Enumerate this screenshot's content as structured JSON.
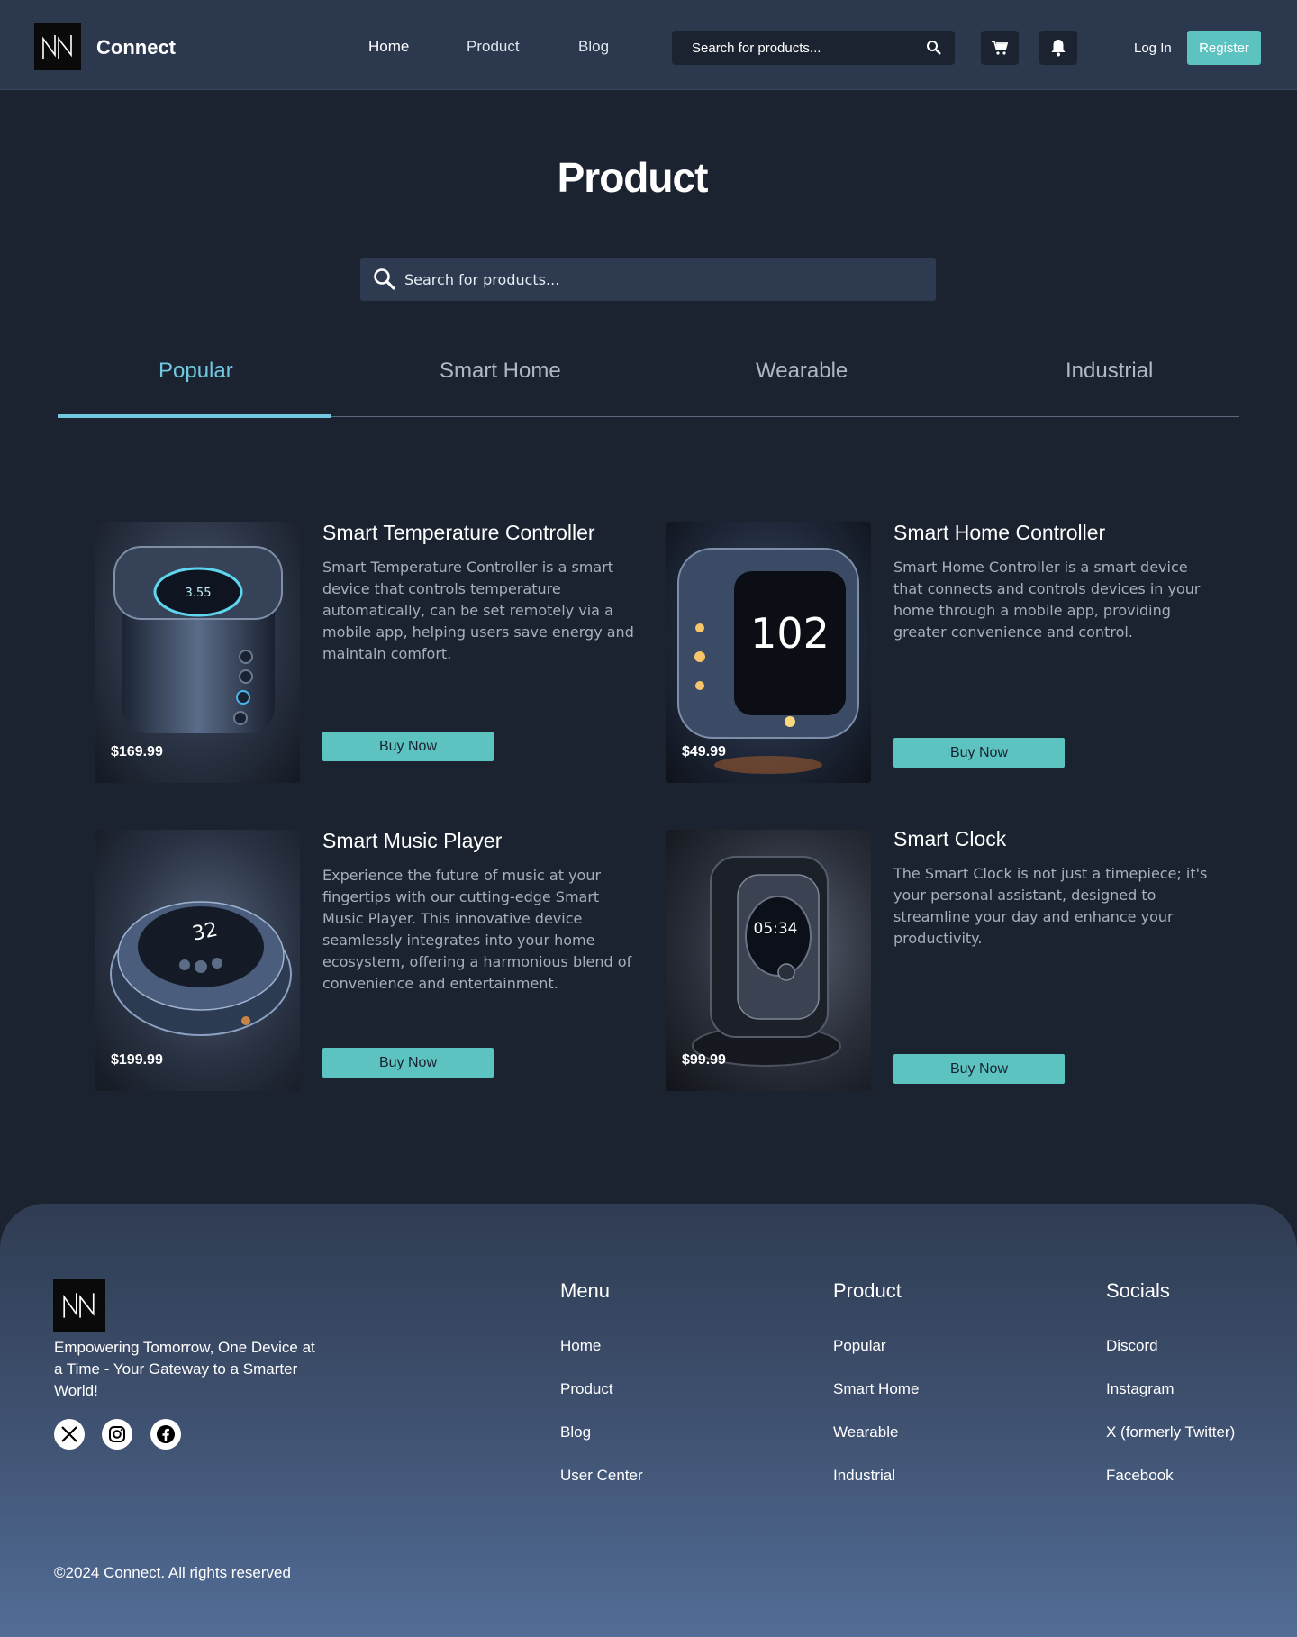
{
  "header": {
    "brand": "Connect",
    "nav": [
      "Home",
      "Product",
      "Blog"
    ],
    "search_placeholder": "Search for products...",
    "login": "Log In",
    "register": "Register"
  },
  "main": {
    "title": "Product",
    "search_placeholder": "Search for products...",
    "tabs": [
      "Popular",
      "Smart Home",
      "Wearable",
      "Industrial"
    ],
    "active_tab": "Popular",
    "products": [
      {
        "name": "Smart Temperature Controller",
        "description": "Smart Temperature Controller is a smart device that controls temperature automatically, can be set remotely via a mobile app, helping users save energy and maintain comfort.",
        "price": "$169.99",
        "cta": "Buy Now",
        "screen_text": "3.55"
      },
      {
        "name": "Smart Home Controller",
        "description": "Smart Home Controller is a smart device that connects and controls devices in your home through a mobile app, providing greater convenience and control.",
        "price": "$49.99",
        "cta": "Buy Now",
        "screen_text": "102"
      },
      {
        "name": "Smart Music Player",
        "description": "Experience the future of music at  your fingertips with our cutting-edge Smart Music Player. This  innovative device seamlessly integrates into your home ecosystem,  offering a harmonious blend of convenience and entertainment.",
        "price": "$199.99",
        "cta": "Buy Now",
        "screen_text": "32"
      },
      {
        "name": "Smart Clock",
        "description": "The Smart Clock is not just a  timepiece; it's your personal assistant, designed to streamline your day and enhance your productivity.",
        "price": "$99.99",
        "cta": "Buy Now",
        "screen_text": "05:34"
      }
    ]
  },
  "footer": {
    "tagline": "Empowering Tomorrow, One Device at a Time - Your Gateway to a Smarter World!",
    "columns": [
      {
        "heading": "Menu",
        "links": [
          "Home",
          "Product",
          "Blog",
          "User Center"
        ]
      },
      {
        "heading": "Product",
        "links": [
          "Popular",
          "Smart Home",
          "Wearable",
          "Industrial"
        ]
      },
      {
        "heading": "Socials",
        "links": [
          "Discord",
          "Instagram",
          "X (formerly Twitter)",
          "Facebook"
        ]
      }
    ],
    "social_icons": [
      "x-icon",
      "instagram-icon",
      "facebook-icon"
    ],
    "copyright": "©2024 Connect. All rights reserved"
  },
  "colors": {
    "header_bg": "#2b384d",
    "page_bg": "#1b2230",
    "accent": "#5cc3c0",
    "tab_active": "#71c8e0"
  }
}
